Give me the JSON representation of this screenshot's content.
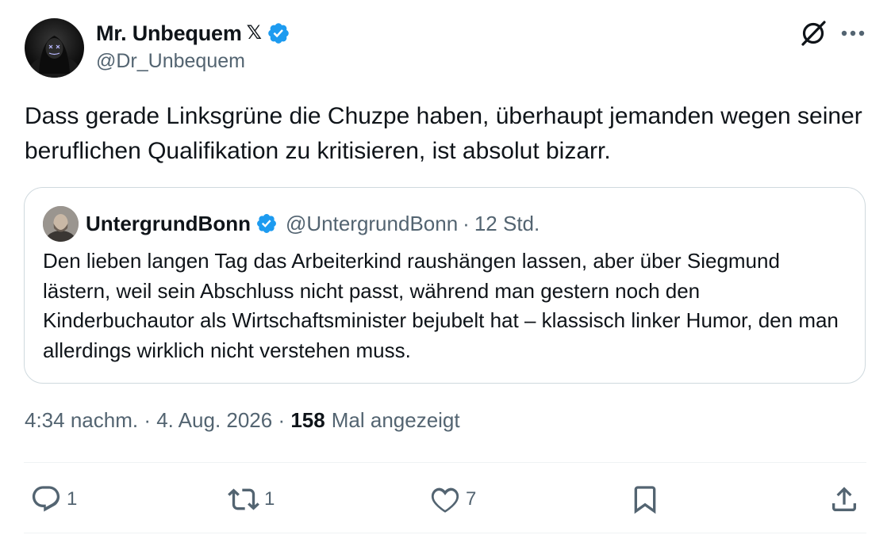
{
  "author": {
    "display_name": "Mr. Unbequem",
    "x_badge": "𝕏",
    "handle": "@Dr_Unbequem"
  },
  "tweet": {
    "text": "Dass gerade Linksgrüne die Chuzpe haben, überhaupt jemanden wegen seiner beruflichen Qualifikation zu kritisieren, ist absolut bizarr."
  },
  "quote": {
    "name": "UntergrundBonn",
    "handle": "@UntergrundBonn",
    "separator": "·",
    "time": "12 Std.",
    "text": "Den lieben langen Tag das Arbeiterkind raushängen lassen, aber über Siegmund lästern, weil sein Abschluss nicht passt, während man gestern noch den Kinderbuchautor als Wirtschaftsminister bejubelt hat – klassisch linker Humor, den man allerdings wirklich nicht verstehen muss."
  },
  "meta": {
    "time": "4:34 nachm.",
    "sep1": " · ",
    "date": "4. Aug. 2026",
    "sep2": " · ",
    "views_count": "158",
    "views_label": "Mal angezeigt"
  },
  "actions": {
    "reply_count": "1",
    "retweet_count": "1",
    "like_count": "7"
  },
  "icons": {
    "top": [
      "grok-icon",
      "more-icon"
    ],
    "actions": [
      "reply-icon",
      "retweet-icon",
      "like-icon",
      "bookmark-icon",
      "share-icon"
    ]
  },
  "colors": {
    "verified": "#1d9bf0",
    "secondary_text": "#536471",
    "primary_text": "#0f1419"
  }
}
